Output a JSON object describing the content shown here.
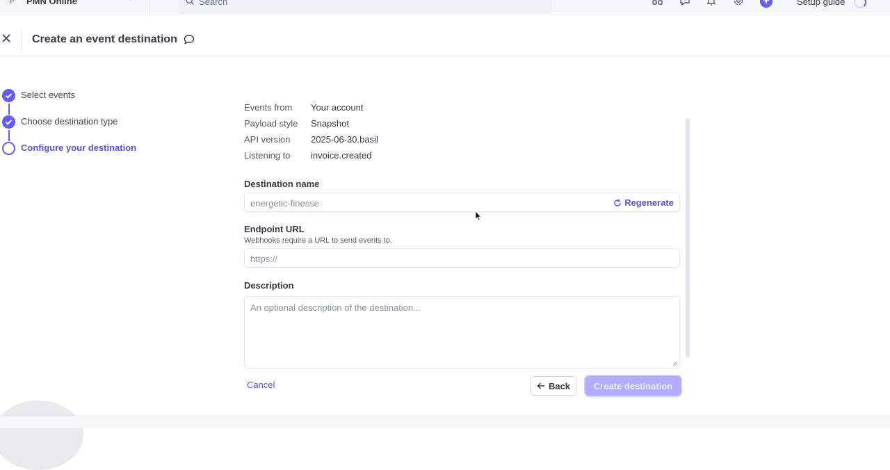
{
  "topbar": {
    "account_letter": "P",
    "account_name": "PMN Online",
    "search_placeholder": "Search",
    "setup_guide_label": "Setup guide",
    "plus_label": "+"
  },
  "header": {
    "title": "Create an event destination"
  },
  "steps": [
    {
      "label": "Select events",
      "state": "done"
    },
    {
      "label": "Choose destination type",
      "state": "done"
    },
    {
      "label": "Configure your destination",
      "state": "current"
    }
  ],
  "summary": [
    {
      "key": "Events from",
      "value": "Your account"
    },
    {
      "key": "Payload style",
      "value": "Snapshot"
    },
    {
      "key": "API version",
      "value": "2025-06-30.basil"
    },
    {
      "key": "Listening to",
      "value": "invoice.created"
    }
  ],
  "form": {
    "destination_name": {
      "label": "Destination name",
      "placeholder": "energetic-finesse",
      "regenerate_label": "Regenerate"
    },
    "endpoint_url": {
      "label": "Endpoint URL",
      "help": "Webhooks require a URL to send events to.",
      "placeholder": "https://"
    },
    "description": {
      "label": "Description",
      "placeholder": "An optional description of the destination..."
    }
  },
  "footer": {
    "cancel_label": "Cancel",
    "back_label": "Back",
    "create_label": "Create destination"
  },
  "colors": {
    "accent": "#635bff",
    "accent_text": "#5851df",
    "create_disabled": "#b3abff"
  },
  "icons": [
    "chevron-down-icon",
    "search-icon",
    "apps-icon",
    "help-icon",
    "bell-icon",
    "gear-icon",
    "plus-icon",
    "spinner-icon",
    "close-icon",
    "comment-icon",
    "check-icon",
    "regenerate-icon",
    "arrow-left-icon"
  ]
}
